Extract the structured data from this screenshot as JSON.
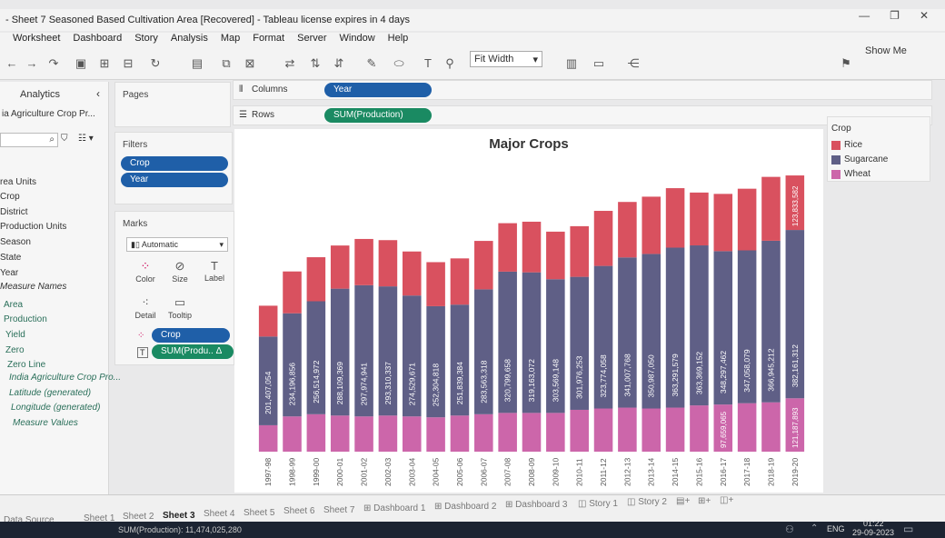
{
  "window": {
    "title": "- Sheet 7 Seasoned Based Cultivation Area [Recovered] - Tableau license expires in 4 days"
  },
  "menu": [
    "Worksheet",
    "Dashboard",
    "Story",
    "Analysis",
    "Map",
    "Format",
    "Server",
    "Window",
    "Help"
  ],
  "toolbar": {
    "fit": "Fit Width",
    "show_me": "Show Me"
  },
  "left": {
    "tab": "Analytics",
    "datasource": "ia Agriculture Crop Pr...",
    "fields": [
      "rea Units",
      "Crop",
      "District",
      "Production Units",
      "Season",
      "State",
      "Year",
      "Measure Names"
    ],
    "measures": [
      "Area",
      "Production",
      "Yield",
      "Zero",
      "Zero Line",
      "India Agriculture Crop Pro...",
      "Latitude (generated)",
      "Longitude (generated)",
      "Measure Values"
    ]
  },
  "shelves": {
    "pages": "Pages",
    "filters": "Filters",
    "filter_pills": [
      "Crop",
      "Year"
    ],
    "marks": "Marks",
    "mark_type": "Automatic",
    "mark_buttons": [
      "Color",
      "Size",
      "Label",
      "Detail",
      "Tooltip"
    ],
    "mark_pills": [
      "Crop",
      "SUM(Produ.. Δ"
    ],
    "columns_label": "Columns",
    "columns_pill": "Year",
    "rows_label": "Rows",
    "rows_pill": "SUM(Production)"
  },
  "legend": {
    "title": "Crop",
    "items": [
      {
        "name": "Rice",
        "color": "#d9515f"
      },
      {
        "name": "Sugarcane",
        "color": "#5f5f86"
      },
      {
        "name": "Wheat",
        "color": "#cc66aa"
      }
    ]
  },
  "chart_data": {
    "type": "bar",
    "stacked": true,
    "title": "Major Crops",
    "categories": [
      "1997-98",
      "1998-99",
      "1999-00",
      "2000-01",
      "2001-02",
      "2002-03",
      "2003-04",
      "2004-05",
      "2005-06",
      "2006-07",
      "2007-08",
      "2008-09",
      "2009-10",
      "2010-11",
      "2011-12",
      "2012-13",
      "2013-14",
      "2014-15",
      "2015-16",
      "2016-17",
      "2017-18",
      "2018-19",
      "2019-20"
    ],
    "series": [
      {
        "name": "Wheat",
        "color": "#cc66aa",
        "values": [
          60,
          80,
          85,
          82,
          80,
          82,
          80,
          78,
          82,
          85,
          88,
          88,
          88,
          95,
          98,
          100,
          98,
          100,
          105,
          107,
          110,
          112,
          121.187893
        ]
      },
      {
        "name": "Sugarcane",
        "color": "#5f5f86",
        "values": [
          201.407054,
          234.196856,
          256.514972,
          288.109369,
          297.974941,
          293.310337,
          274.529671,
          252.304818,
          251.839384,
          283.563318,
          320.799658,
          319.163072,
          303.569148,
          301.976253,
          323.774058,
          341.007768,
          350.98705,
          363.291579,
          363.369152,
          348.297462,
          347.058079,
          366.945212,
          382.161312
        ]
      },
      {
        "name": "Rice",
        "color": "#d9515f",
        "values": [
          70,
          95,
          100,
          98,
          105,
          105,
          100,
          100,
          105,
          110,
          110,
          115,
          108,
          115,
          125,
          126,
          130,
          135,
          120,
          130,
          140,
          145,
          123.833582
        ]
      }
    ],
    "bar_labels_sugarcane": [
      "201,407,054",
      "234,196,856",
      "256,514,972",
      "288,109,369",
      "297,974,941",
      "293,310,337",
      "274,529,671",
      "252,304,818",
      "251,839,384",
      "283,563,318",
      "320,799,658",
      "319,163,072",
      "303,569,148",
      "301,976,253",
      "323,774,058",
      "341,007,768",
      "350,987,050",
      "363,291,579",
      "363,369,152",
      "348,297,462",
      "347,058,079",
      "366,945,212",
      "382,161,312"
    ],
    "extra_labels": {
      "last_rice": "123,833,582",
      "last_wheat": "121,187,893",
      "y2016_wheat": "97,659,065"
    },
    "ylim": [
      0,
      650
    ],
    "xlabel": "",
    "ylabel": ""
  },
  "tabs": [
    "Data Source",
    "Sheet 1",
    "Sheet 2",
    "Sheet 3",
    "Sheet 4",
    "Sheet 5",
    "Sheet 6",
    "Sheet 7",
    "Dashboard 1",
    "Dashboard 2",
    "Dashboard 3",
    "Story 1",
    "Story 2"
  ],
  "active_tab": "Sheet 3",
  "status": {
    "text": "SUM(Production): 11,474,025,280",
    "lang": "ENG",
    "time": "01:22",
    "date": "29-09-2023"
  }
}
